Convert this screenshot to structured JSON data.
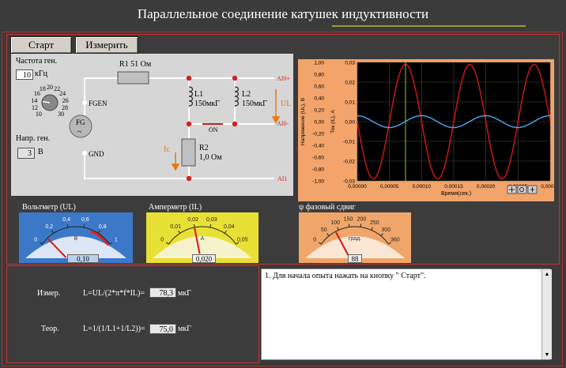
{
  "window": {
    "title": "Параллельное соединение катушек индуктивности"
  },
  "toolbar": {
    "start_label": "Старт",
    "measure_label": "Измерить"
  },
  "generator": {
    "freq_label": "Частота ген.",
    "freq_value": "10",
    "freq_unit": "кГц",
    "dial_ticks": [
      "10",
      "12",
      "14",
      "16",
      "18",
      "20",
      "22",
      "24",
      "26",
      "28",
      "30"
    ],
    "dial_value": 14,
    "volt_label": "Напр. ген.",
    "volt_value": "3",
    "volt_unit": "В"
  },
  "circuit": {
    "r1": "R1 51 Ом",
    "l1": "L1",
    "l1_val": "150мкГ",
    "l2": "L2",
    "l2_val": "150мкГ",
    "r2": "R2",
    "r2_val": "1,0 Ом",
    "fgen": "FGEN",
    "gnd": "GND",
    "fg": "FG",
    "fg_sym": "~",
    "ul": "UL",
    "ic": "Ic",
    "on": "ON",
    "ai0p": "AI0+",
    "ai0m": "AI0-",
    "ai1": "AI1"
  },
  "chart_data": {
    "type": "line",
    "xlabel": "Время(сек.)",
    "ylabel_left": "Напряжение (UL), В",
    "ylabel_right": "Ток (IL), А",
    "xlim": [
      0,
      0.0003
    ],
    "ylim_left": [
      -1.0,
      1.0
    ],
    "ylim_right": [
      -0.03,
      0.03
    ],
    "x_ticks": [
      "0,00000",
      "0,00005",
      "0,00010",
      "0,00015",
      "0,00020",
      "0,00025",
      "0,00030"
    ],
    "y_left_ticks": [
      "1,00",
      "0,80",
      "0,60",
      "0,40",
      "0,20",
      "0,00",
      "-0,20",
      "-0,40",
      "-0,60",
      "-0,80",
      "-1,00"
    ],
    "y_right_ticks": [
      "0,03",
      "0,02",
      "0,01",
      "0,00",
      "-0,01",
      "-0,02",
      "-0,03"
    ],
    "grid": true,
    "cursor_x": 7.5e-05,
    "series": [
      {
        "axis": "right",
        "color": "#c81818",
        "amplitude": 0.029,
        "frequency": 10000,
        "phase_deg": 0
      },
      {
        "axis": "left",
        "color": "#4aa0e8",
        "amplitude": 0.1,
        "frequency": 10000,
        "phase_deg": 88
      }
    ]
  },
  "meters": {
    "voltmeter": {
      "title": "Вольтметр (UL)",
      "unit": "В",
      "min": 0,
      "max": 1,
      "value": 0.1,
      "display": "0,10",
      "ticks": [
        "0",
        "0,2",
        "0,4",
        "0,6",
        "0,8",
        "1"
      ]
    },
    "ammeter": {
      "title": "Амперметр (IL)",
      "unit": "А",
      "min": 0,
      "max": 0.05,
      "value": 0.02,
      "display": "0,020",
      "ticks": [
        "0",
        "0,01",
        "0,02",
        "0,03",
        "0,04",
        "0,05"
      ]
    },
    "phase": {
      "title": "ψ фазовый сдвиг",
      "unit": "град.",
      "min": 0,
      "max": 360,
      "value": 88,
      "display": "88",
      "ticks": [
        "0",
        "50",
        "100",
        "150",
        "200",
        "250",
        "300",
        "360"
      ]
    }
  },
  "calc": {
    "meas_label": "Измер.",
    "meas_formula": "L=UL/(2*π*f*IL)=",
    "meas_value": "78,3",
    "meas_unit": "мкГ",
    "theo_label": "Теор.",
    "theo_formula": "L=1/(1/L1+1/L2))=",
    "theo_value": "75,0",
    "theo_unit": "мкГ"
  },
  "instructions": {
    "text": "1. Для начала опыта нажать на кнопку \" Старт\"."
  },
  "colors": {
    "panel_border": "#c23434",
    "chart_bg": "#000000",
    "chart_frame": "#f2a46a"
  }
}
